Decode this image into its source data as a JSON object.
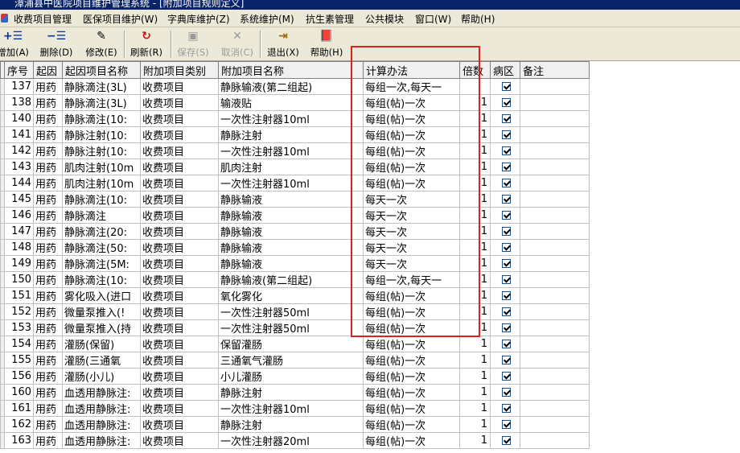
{
  "window": {
    "title": "漳浦县中医院项目维护管理系统 - [附加项目规则定义]"
  },
  "menu": [
    "收费项目管理",
    "医保项目维护(W)",
    "字典库维护(Z)",
    "系统维护(M)",
    "抗生素管理",
    "公共模块",
    "窗口(W)",
    "帮助(H)"
  ],
  "toolbar": {
    "add": {
      "label": "增加(A)",
      "icon": "add-icon"
    },
    "delete": {
      "label": "删除(D)",
      "icon": "delete-icon"
    },
    "edit": {
      "label": "修改(E)",
      "icon": "edit-icon"
    },
    "refresh": {
      "label": "刷新(R)",
      "icon": "refresh-icon"
    },
    "save": {
      "label": "保存(S)",
      "icon": "save-icon"
    },
    "cancel": {
      "label": "取消(C)",
      "icon": "cancel-icon"
    },
    "exit": {
      "label": "退出(X)",
      "icon": "exit-icon"
    },
    "help": {
      "label": "帮助(H)",
      "icon": "help-book-icon"
    }
  },
  "table": {
    "columns": [
      "序号",
      "起因",
      "起因项目名称",
      "附加项目类别",
      "附加项目名称",
      "计算办法",
      "倍数",
      "病区",
      "备注"
    ],
    "rows": [
      [
        "137",
        "用药",
        "静脉滴注(3L)",
        "收费项目",
        "静脉输液(第二组起)",
        "每组一次,每天一",
        "",
        true,
        ""
      ],
      [
        "138",
        "用药",
        "静脉滴注(3L)",
        "收费项目",
        "输液贴",
        "每组(帖)一次",
        "1",
        true,
        ""
      ],
      [
        "140",
        "用药",
        "静脉滴注(10:",
        "收费项目",
        "一次性注射器10ml",
        "每组(帖)一次",
        "1",
        true,
        ""
      ],
      [
        "141",
        "用药",
        "静脉注射(10:",
        "收费项目",
        "静脉注射",
        "每组(帖)一次",
        "1",
        true,
        ""
      ],
      [
        "142",
        "用药",
        "静脉注射(10:",
        "收费项目",
        "一次性注射器10ml",
        "每组(帖)一次",
        "1",
        true,
        ""
      ],
      [
        "143",
        "用药",
        "肌肉注射(10m",
        "收费项目",
        "肌肉注射",
        "每组(帖)一次",
        "1",
        true,
        ""
      ],
      [
        "144",
        "用药",
        "肌肉注射(10m",
        "收费项目",
        "一次性注射器10ml",
        "每组(帖)一次",
        "1",
        true,
        ""
      ],
      [
        "145",
        "用药",
        "静脉滴注(10:",
        "收费项目",
        "静脉输液",
        "每天一次",
        "1",
        true,
        ""
      ],
      [
        "146",
        "用药",
        "静脉滴注",
        "收费项目",
        "静脉输液",
        "每天一次",
        "1",
        true,
        ""
      ],
      [
        "147",
        "用药",
        "静脉滴注(20:",
        "收费项目",
        "静脉输液",
        "每天一次",
        "1",
        true,
        ""
      ],
      [
        "148",
        "用药",
        "静脉滴注(50:",
        "收费项目",
        "静脉输液",
        "每天一次",
        "1",
        true,
        ""
      ],
      [
        "149",
        "用药",
        "静脉滴注(5M:",
        "收费项目",
        "静脉输液",
        "每天一次",
        "1",
        true,
        ""
      ],
      [
        "150",
        "用药",
        "静脉滴注(10:",
        "收费项目",
        "静脉输液(第二组起)",
        "每组一次,每天一",
        "1",
        true,
        ""
      ],
      [
        "151",
        "用药",
        "雾化吸入(进口",
        "收费项目",
        "氧化雾化",
        "每组(帖)一次",
        "1",
        true,
        ""
      ],
      [
        "152",
        "用药",
        "微量泵推入(!",
        "收费项目",
        "一次性注射器50ml",
        "每组(帖)一次",
        "1",
        true,
        ""
      ],
      [
        "153",
        "用药",
        "微量泵推入(持",
        "收费项目",
        "一次性注射器50ml",
        "每组(帖)一次",
        "1",
        true,
        ""
      ],
      [
        "154",
        "用药",
        "灌肠(保留)",
        "收费项目",
        "保留灌肠",
        "每组(帖)一次",
        "1",
        true,
        ""
      ],
      [
        "155",
        "用药",
        "灌肠(三通氧",
        "收费项目",
        "三通氧气灌肠",
        "每组(帖)一次",
        "1",
        true,
        ""
      ],
      [
        "156",
        "用药",
        "灌肠(小儿)",
        "收费项目",
        "小儿灌肠",
        "每组(帖)一次",
        "1",
        true,
        ""
      ],
      [
        "160",
        "用药",
        "血透用静脉注:",
        "收费项目",
        "静脉注射",
        "每组(帖)一次",
        "1",
        true,
        ""
      ],
      [
        "161",
        "用药",
        "血透用静脉注:",
        "收费项目",
        "一次性注射器10ml",
        "每组(帖)一次",
        "1",
        true,
        ""
      ],
      [
        "162",
        "用药",
        "血透用静脉注:",
        "收费项目",
        "静脉注射",
        "每组(帖)一次",
        "1",
        true,
        ""
      ],
      [
        "163",
        "用药",
        "血透用静脉注:",
        "收费项目",
        "一次性注射器20ml",
        "每组(帖)一次",
        "1",
        true,
        ""
      ]
    ]
  },
  "colors": {
    "title_bar": "#0a246a",
    "toolbar_bg": "#ece9d8",
    "highlight_box": "#e02020"
  }
}
